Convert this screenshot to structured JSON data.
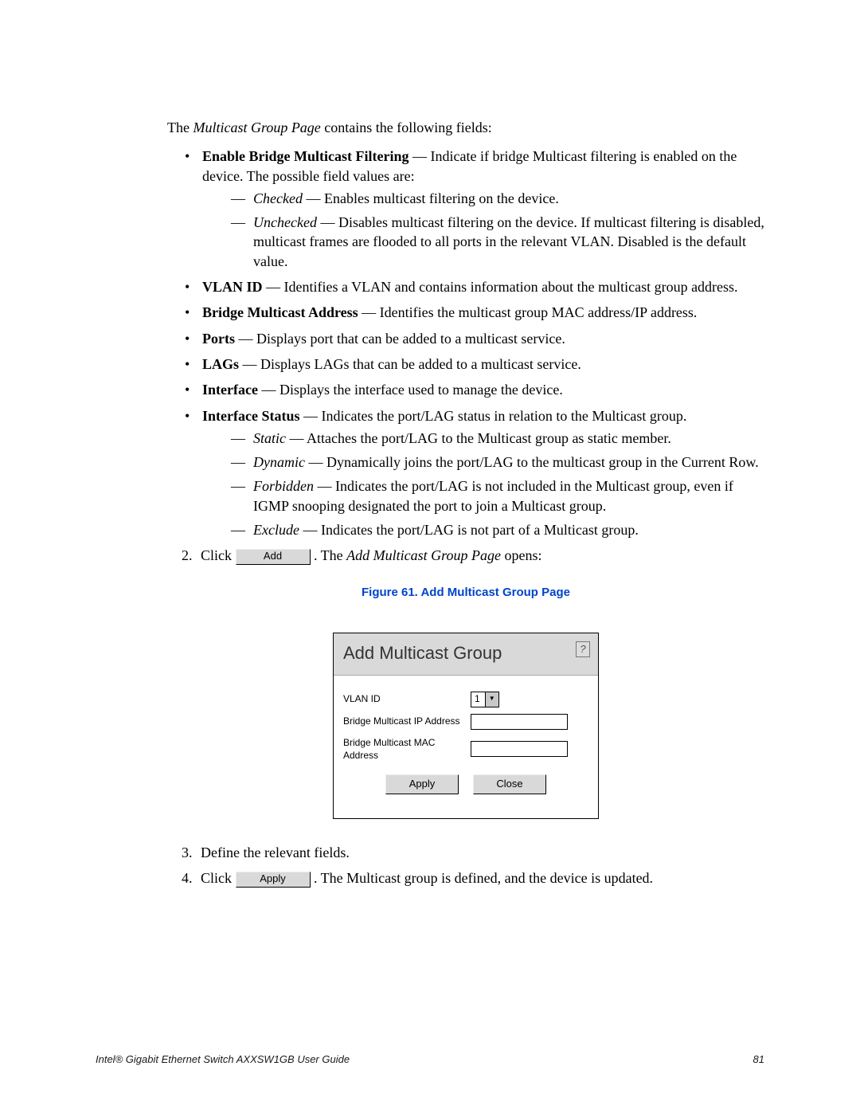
{
  "intro": {
    "pre": "The ",
    "page_name": "Multicast Group Page",
    "post": " contains the following fields:"
  },
  "field_enable": {
    "name": "Enable Bridge Multicast Filtering",
    "desc": " — Indicate if bridge Multicast filtering is enabled on the device. The possible field values are:",
    "checked_name": "Checked",
    "checked_desc": " — Enables multicast filtering on the device.",
    "unchecked_name": "Unchecked",
    "unchecked_desc": " — Disables multicast filtering on the device. If multicast filtering is disabled, multicast frames are flooded to all ports in the relevant VLAN. Disabled is the default value."
  },
  "field_vlan": {
    "name": "VLAN ID",
    "desc": " — Identifies a VLAN and contains information about the multicast group address."
  },
  "field_mac": {
    "name": "Bridge Multicast Address",
    "desc": " — Identifies the multicast group MAC address/IP address."
  },
  "field_ports": {
    "name": "Ports",
    "desc": " — Displays port that can be added to a multicast service."
  },
  "field_lags": {
    "name": "LAGs",
    "desc": " — Displays LAGs that can be added to a multicast service."
  },
  "field_interface": {
    "name": "Interface",
    "desc": " — Displays the interface used to manage the device."
  },
  "field_status": {
    "name": "Interface Status",
    "desc": " — Indicates the port/LAG status in relation to the Multicast group.",
    "static_name": "Static",
    "static_desc": " — Attaches the port/LAG to the Multicast group as static member.",
    "dynamic_name": "Dynamic",
    "dynamic_desc": " — Dynamically joins the port/LAG to the multicast group in the Current Row.",
    "forbidden_name": "Forbidden",
    "forbidden_desc": " — Indicates the port/LAG is not included in the Multicast group, even if IGMP snooping designated the port to join a Multicast group.",
    "exclude_name": "Exclude",
    "exclude_desc": " — Indicates the port/LAG is not part of a Multicast group."
  },
  "step2": {
    "num": "2.",
    "pre": "Click ",
    "btn": "Add",
    "mid": ". The ",
    "page": "Add Multicast Group Page",
    "post": " opens:"
  },
  "figure_caption": "Figure 61. Add Multicast Group Page",
  "dialog": {
    "title": "Add Multicast Group",
    "help": "?",
    "vlan_label": "VLAN ID",
    "vlan_value": "1",
    "ip_label": "Bridge Multicast IP Address",
    "mac_label": "Bridge Multicast MAC Address",
    "apply": "Apply",
    "close": "Close"
  },
  "step3": {
    "num": "3.",
    "text": "Define the relevant fields."
  },
  "step4": {
    "num": "4.",
    "pre": "Click ",
    "btn": "Apply",
    "post": " . The Multicast group is defined, and the device is updated."
  },
  "footer": {
    "left": "Intel® Gigabit Ethernet Switch AXXSW1GB User Guide",
    "right": "81"
  }
}
